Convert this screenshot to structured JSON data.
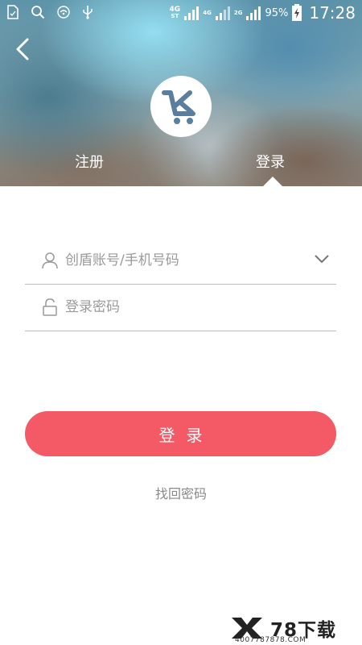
{
  "status_bar": {
    "network_top": "4G",
    "network_sub": "ST",
    "network2": "4G",
    "network3": "2G",
    "battery": "95%",
    "time": "17:28"
  },
  "header": {
    "tabs": [
      {
        "label": "注册",
        "active": false
      },
      {
        "label": "登录",
        "active": true
      }
    ]
  },
  "form": {
    "account_placeholder": "创盾账号/手机号码",
    "account_value": "",
    "password_placeholder": "登录密码",
    "password_value": "",
    "login_label": "登录",
    "forgot_label": "找回密码"
  },
  "watermark": {
    "name": "78下载",
    "url": "4007787878.COM"
  },
  "colors": {
    "accent": "#f35a66",
    "logo_mark": "#5a7f9e"
  }
}
